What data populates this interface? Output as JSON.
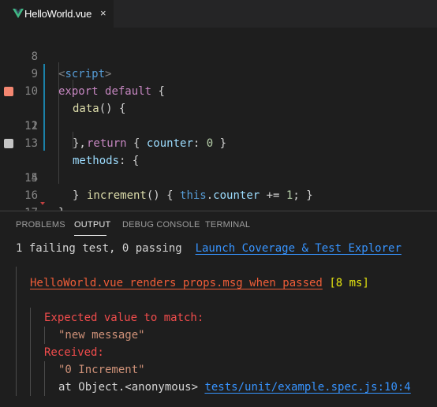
{
  "tab": {
    "label": "HelloWorld.vue",
    "close_glyph": "×",
    "icon": "vue-logo-icon",
    "icon_colors": [
      "#41b883",
      "#35495e"
    ]
  },
  "editor": {
    "line_numbers": [
      "8",
      "9",
      "10",
      "11",
      "12",
      "13",
      "14",
      "15",
      "16",
      "17"
    ],
    "lines": {
      "l8": {
        "open": "<",
        "tag": "script",
        "close": ">"
      },
      "l9": {
        "kw1": "export",
        "kw2": "default",
        "brace": " {"
      },
      "l10": {
        "fn": "data",
        "rest": "() {"
      },
      "l11": {
        "kw": "return",
        "open": " { ",
        "prop": "counter",
        "colon": ": ",
        "num": "0",
        "close": " }"
      },
      "l12": {
        "text": "},"
      },
      "l13": {
        "prop": "methods",
        "rest": ": {"
      },
      "l14": {
        "fn": "increment",
        "rest1": "() { ",
        "this": "this",
        "dot": ".",
        "prop": "counter",
        "op": " += ",
        "num": "1",
        "rest2": "; }"
      },
      "l15": {
        "text": "}"
      },
      "l16": {
        "text": "}"
      },
      "l17": {
        "open": "</",
        "tag": "script",
        "close": ">"
      }
    },
    "breakpoints": {
      "l11": {
        "state": "failed",
        "color": "#f48771"
      },
      "l14": {
        "state": "unverified",
        "color": "#c5c5c5"
      }
    },
    "colors": {
      "accent_bar": "#1b81a8"
    }
  },
  "panel": {
    "tabs": [
      "PROBLEMS",
      "OUTPUT",
      "DEBUG CONSOLE",
      "TERMINAL"
    ],
    "active_tab": "OUTPUT",
    "summary": "1 failing test, 0 passing",
    "launch_link": "Launch Coverage & Test Explorer",
    "failure": {
      "title": "HelloWorld.vue renders props.msg when passed",
      "duration": "[8 ms]",
      "expected_label": "Expected value to match:",
      "expected_value": "\"new message\"",
      "received_label": "Received:",
      "received_value": "\"0 Increment\"",
      "at_text": "at Object.<anonymous> ",
      "location_link": "tests/unit/example.spec.js:10:4"
    }
  }
}
